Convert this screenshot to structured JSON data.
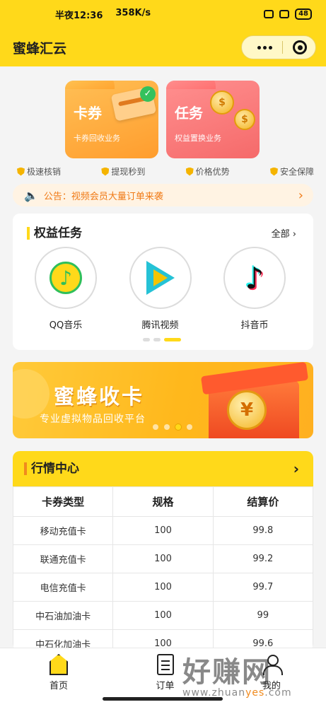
{
  "status_bar": {
    "carrier_time": "半夜12:36",
    "speed": "358K/s",
    "battery": "48"
  },
  "header": {
    "title": "蜜蜂汇云"
  },
  "feature_cards": [
    {
      "title": "卡券",
      "subtitle": "卡券回收业务"
    },
    {
      "title": "任务",
      "subtitle": "权益置换业务"
    }
  ],
  "badges": [
    "极速核销",
    "提现秒到",
    "价格优势",
    "安全保障"
  ],
  "notice": {
    "text": "公告：视频会员大量订单来袭"
  },
  "rights_tasks": {
    "title": "权益任务",
    "all_label": "全部",
    "apps": [
      {
        "label": "QQ音乐",
        "icon": "qq-music-icon"
      },
      {
        "label": "腾讯视频",
        "icon": "tencent-video-icon"
      },
      {
        "label": "抖音币",
        "icon": "douyin-icon"
      }
    ]
  },
  "banner": {
    "title": "蜜蜂收卡",
    "subtitle": "专业虚拟物品回收平台",
    "coin_symbol": "¥"
  },
  "market": {
    "title": "行情中心",
    "columns": [
      "卡券类型",
      "规格",
      "结算价"
    ],
    "rows": [
      [
        "移动充值卡",
        "100",
        "99.8"
      ],
      [
        "联通充值卡",
        "100",
        "99.2"
      ],
      [
        "电信充值卡",
        "100",
        "99.7"
      ],
      [
        "中石油加油卡",
        "100",
        "99"
      ],
      [
        "中石化加油卡",
        "100",
        "99.6"
      ]
    ]
  },
  "tabbar": {
    "home": "首页",
    "orders": "订单",
    "mine": "我的"
  },
  "watermark": {
    "main": "好赚网",
    "url_prefix": "www.zhuan",
    "url_accent": "yes",
    "url_suffix": ".com"
  },
  "colors": {
    "brand_yellow": "#ffd91a",
    "notice_orange": "#f07a16",
    "card_orange": "#ffa53a",
    "card_red": "#f56a6a"
  }
}
